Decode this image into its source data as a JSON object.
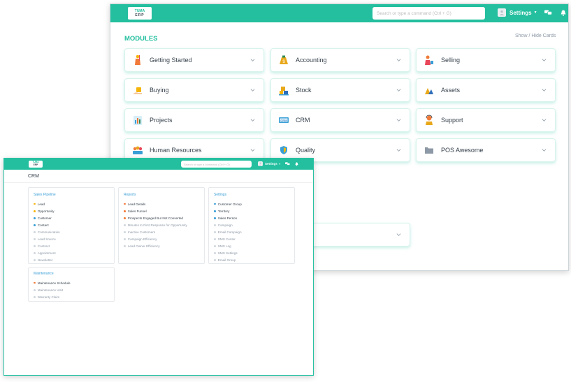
{
  "back": {
    "search_placeholder": "Search or type a command (Ctrl + G)",
    "settings_label": "Settings",
    "modules_title": "MODULES",
    "show_hide": "Show / Hide Cards",
    "cards": [
      {
        "label": "Getting Started",
        "icon": "flag-person-icon",
        "color": "#f07a38"
      },
      {
        "label": "Accounting",
        "icon": "money-bag-icon",
        "color": "#e8a81a"
      },
      {
        "label": "Selling",
        "icon": "salesman-icon",
        "color": "#e9465a"
      },
      {
        "label": "Buying",
        "icon": "hand-cart-icon",
        "color": "#f5b40a"
      },
      {
        "label": "Stock",
        "icon": "boxes-icon",
        "color": "#2f6eba"
      },
      {
        "label": "Assets",
        "icon": "assets-icon",
        "color": "#e8a81a"
      },
      {
        "label": "Projects",
        "icon": "project-chart-icon",
        "color": "#3a9fd6"
      },
      {
        "label": "CRM",
        "icon": "crm-screen-icon",
        "color": "#3a9fd6"
      },
      {
        "label": "Support",
        "icon": "support-agent-icon",
        "color": "#f07a38"
      },
      {
        "label": "Human Resources",
        "icon": "team-icon",
        "color": "#e9465a"
      },
      {
        "label": "Quality",
        "icon": "shield-icon",
        "color": "#3a9fd6"
      },
      {
        "label": "POS Awesome",
        "icon": "folder-icon",
        "color": "#8d99a6"
      }
    ]
  },
  "front": {
    "logo_top": "TUMA",
    "logo_bottom": "ERP",
    "search_placeholder": "Search or type a command (Ctrl + G)",
    "settings_label": "Settings",
    "page_title": "CRM",
    "sections": {
      "sales_pipeline": {
        "title": "Sales Pipeline",
        "items": [
          {
            "label": "Lead",
            "dot": "yellow"
          },
          {
            "label": "Opportunity",
            "dot": "yellow"
          },
          {
            "label": "Customer",
            "dot": "blue"
          },
          {
            "label": "Contact",
            "dot": "blue"
          },
          {
            "label": "Communication",
            "dot": "none"
          },
          {
            "label": "Lead Source",
            "dot": "none"
          },
          {
            "label": "Contract",
            "dot": "none"
          },
          {
            "label": "Appointment",
            "dot": "none"
          },
          {
            "label": "Newsletter",
            "dot": "none"
          }
        ]
      },
      "reports": {
        "title": "Reports",
        "items": [
          {
            "label": "Lead Details",
            "dot": "orange"
          },
          {
            "label": "Sales Funnel",
            "dot": "orange"
          },
          {
            "label": "Prospects Engaged But Not Converted",
            "dot": "orange"
          },
          {
            "label": "Minutes to First Response for Opportunity",
            "dot": "none"
          },
          {
            "label": "Inactive Customers",
            "dot": "none"
          },
          {
            "label": "Campaign Efficiency",
            "dot": "none"
          },
          {
            "label": "Lead Owner Efficiency",
            "dot": "none"
          }
        ]
      },
      "settings": {
        "title": "Settings",
        "items": [
          {
            "label": "Customer Group",
            "dot": "blue"
          },
          {
            "label": "Territory",
            "dot": "blue"
          },
          {
            "label": "Sales Person",
            "dot": "blue"
          },
          {
            "label": "Campaign",
            "dot": "none"
          },
          {
            "label": "Email Campaign",
            "dot": "none"
          },
          {
            "label": "SMS Center",
            "dot": "none"
          },
          {
            "label": "SMS Log",
            "dot": "none"
          },
          {
            "label": "SMS Settings",
            "dot": "none"
          },
          {
            "label": "Email Group",
            "dot": "none"
          }
        ]
      },
      "maintenance": {
        "title": "Maintenance",
        "items": [
          {
            "label": "Maintenance Schedule",
            "dot": "orange"
          },
          {
            "label": "Maintenance Visit",
            "dot": "none"
          },
          {
            "label": "Warranty Claim",
            "dot": "none"
          }
        ]
      }
    }
  }
}
